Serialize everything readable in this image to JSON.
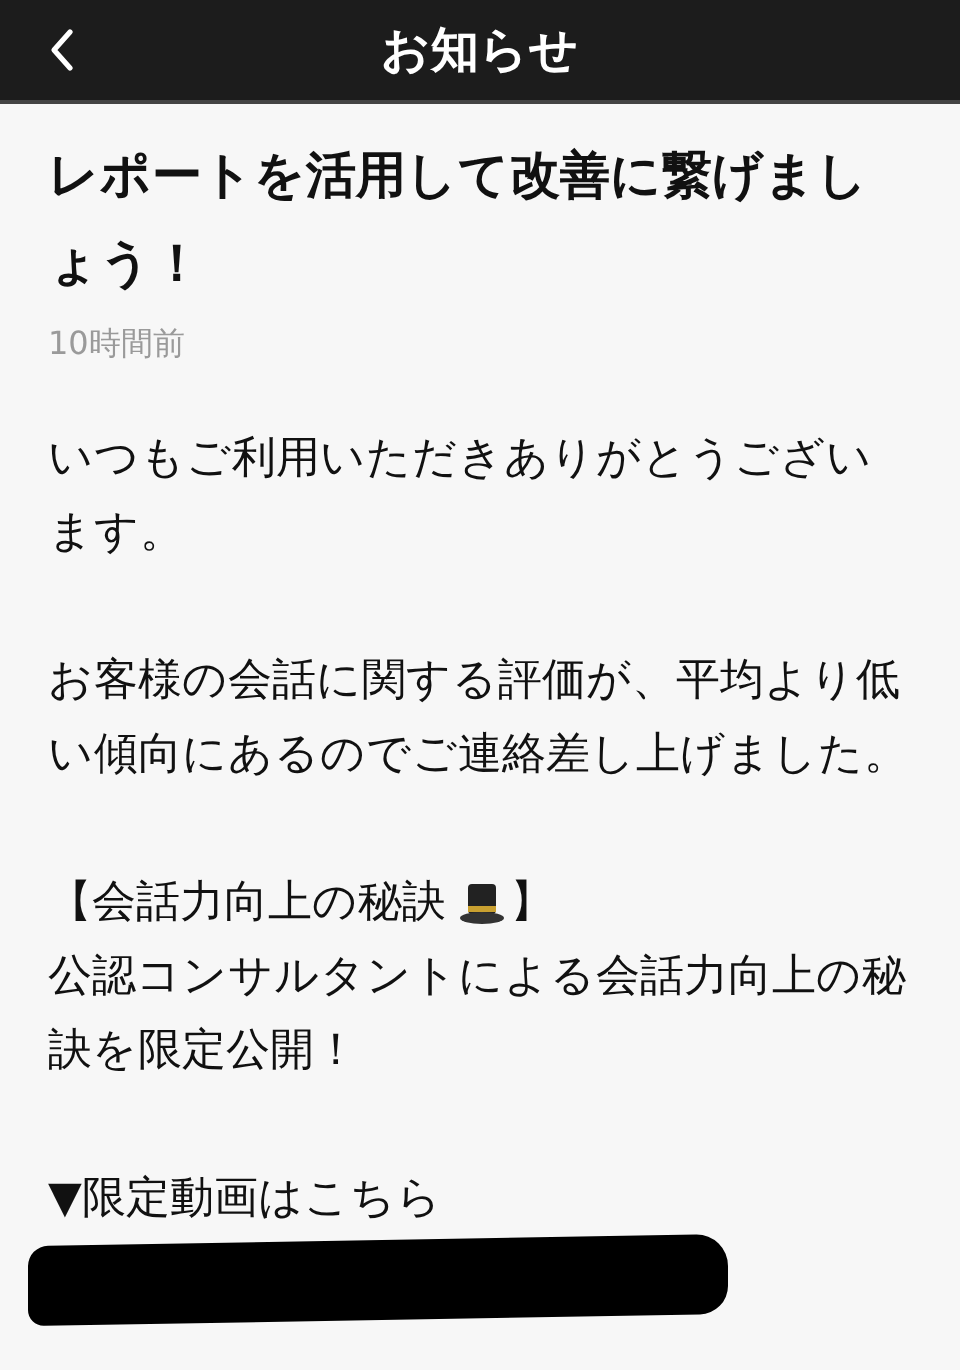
{
  "header": {
    "title": "お知らせ"
  },
  "article": {
    "title": "レポートを活用して改善に繋げましょう！",
    "time": "10時間前",
    "blocks": [
      {
        "kind": "text",
        "text": "いつもご利用いただきありがとうございます。"
      },
      {
        "kind": "spacer"
      },
      {
        "kind": "text",
        "text": "お客様の会話に関する評価が、平均より低い傾向にあるのでご連絡差し上げました。"
      },
      {
        "kind": "spacer"
      },
      {
        "kind": "heading",
        "text": "【会話力向上の秘訣",
        "end": "】"
      },
      {
        "kind": "text",
        "text": "公認コンサルタントによる会話力向上の秘訣を限定公開！"
      },
      {
        "kind": "spacer"
      },
      {
        "kind": "text",
        "text": "▼限定動画はこちら"
      },
      {
        "kind": "redacted"
      }
    ]
  }
}
